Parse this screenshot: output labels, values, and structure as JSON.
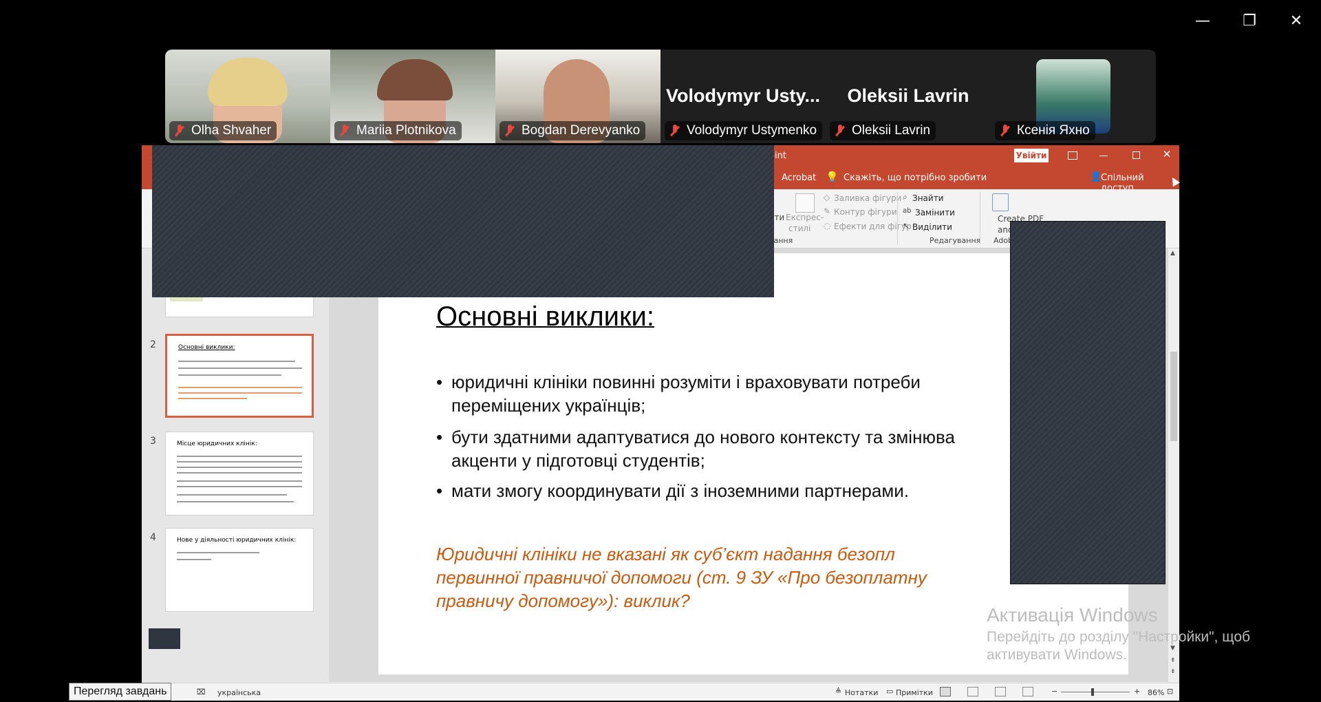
{
  "window_controls": {
    "minimize": "—",
    "restore": "❐",
    "close": "✕"
  },
  "participants": [
    {
      "name": "Olha Shvaher"
    },
    {
      "name": "Mariia Plotnikova"
    },
    {
      "name": "Bogdan Derevyanko"
    },
    {
      "name": "Volodymyr Ustymenko",
      "display_name": "Volodymyr  Usty..."
    },
    {
      "name": "Oleksii Lavrin",
      "display_name": "Oleksii Lavrin"
    },
    {
      "name": "Ксенія Яхно"
    }
  ],
  "app": {
    "title_suffix": "oint",
    "signin_label": "Увійти",
    "tabs": {
      "acrobat": "Acrobat",
      "tell_me": "Скажіть, що потрібно зробити",
      "share": "Спільний доступ"
    },
    "ribbon": {
      "shape_fill": "Заливка фігури",
      "shape_outline": "Контур фігури",
      "shape_effects": "Ефекти для фігур",
      "quick_styles_a": "Експрес-",
      "quick_styles_b": "стилі",
      "ati": "ати",
      "find": "Знайти",
      "replace": "Замінити",
      "select": "Виділити",
      "editing_group": "Редагування",
      "drawing_group_tail": "вання",
      "adobe_tail": "Adob",
      "create_pdf_a": "Create PDF",
      "create_pdf_b": "and"
    },
    "statusbar": {
      "language": "українська",
      "notes": "Нотатки",
      "comments": "Примітки",
      "zoom": "86%"
    }
  },
  "thumbnails": [
    {
      "num": "2",
      "title": "Основні виклики:"
    },
    {
      "num": "3",
      "title": "Місце юридичних клінік:"
    },
    {
      "num": "4",
      "title": "Нове у діяльності юридичних клінік:"
    }
  ],
  "slide": {
    "title": "Основні виклики:",
    "bullets": [
      {
        "line1": "юридичні клініки повинні розуміти і враховувати потреби",
        "line2": "переміщених українців;"
      },
      {
        "line1": " бути здатними адаптуватися до нового контексту та змінюва",
        "line2": "акценти у підготовці студентів;"
      },
      {
        "line1": "мати змогу координувати дії з іноземними партнерами.",
        "line2": ""
      }
    ],
    "bullet_symbol": "•",
    "italic_lines": [
      "Юридичні  клініки  не  вказані  як  суб’єкт  надання  безопл",
      "первинної  правничої  допомоги  (ст.  9  ЗУ  «Про  безоплатну",
      "правничу допомогу»): виклик?"
    ]
  },
  "activation": {
    "title": "Активація Windows",
    "line1": "Перейдіть до розділу \"Настройки\", щоб",
    "line2": "активувати Windows."
  },
  "tooltip": "Перегляд завдань",
  "colors": {
    "accent": "#c4482f",
    "italic_text": "#c55a11",
    "mic_muted": "#e8483e"
  }
}
